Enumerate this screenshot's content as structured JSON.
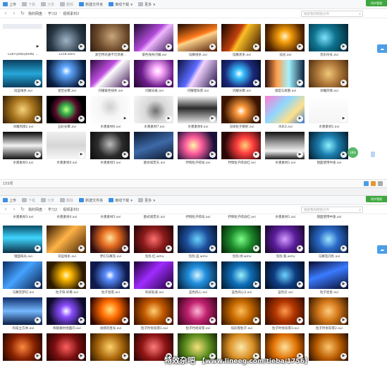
{
  "top": {
    "toolbar": {
      "upload": "上传",
      "download": "下载",
      "share": "分享",
      "delete": "删除",
      "new_folder": "新建文件夹",
      "offline": "离线下载",
      "more": "更多",
      "sync": "同步管理"
    },
    "breadcrumb": [
      "我的网盘",
      "学习2",
      "视频素材2"
    ],
    "search_placeholder": "搜索我的网盘文件",
    "status": "155项",
    "floating_badge": "38%",
    "files": [
      "G(8TQ0N(Q6HN]`...",
      "x258.wmv",
      "演艺特司通不可求要...",
      "紫色线条闪耀.avi",
      "炫舞线条.avi",
      "炫舞黑条.avi",
      "炫光.avi",
      "音乐符号.avi",
      "炫蓝线条.avi",
      "星空光晕.avi",
      "闪耀紫色线条.avi",
      "闪耀光斑.avi",
      "闪耀慢背景.avi",
      "闪耀光晕.avi",
      "渡度与发散.avi",
      "冰雕风情.avi",
      "冰雕风情2.avi",
      "五彩光晕.avi",
      "水墨素材6.avi",
      "水墨素材7.avi",
      "水墨素材8.avi",
      "渲染粒子散射.avi",
      "水彩2.avi",
      "水墨素材2.avi",
      "水墨素材3.avi",
      "水墨素材4.avi",
      "水墨素材5.avi",
      "欧式城堡天.avi",
      "抒情粒子碎动.avi",
      "抒情粒子碎动红.avi",
      "水墨素材1.avi",
      "镜面使用中速.avi"
    ]
  },
  "bottom": {
    "toolbar": {
      "upload": "上传",
      "download": "下载",
      "share": "分享",
      "delete": "删除",
      "new_folder": "新建文件夹",
      "offline": "离线下载",
      "more": "更多",
      "sync": "同步管理"
    },
    "breadcrumb": [
      "我的网盘",
      "学习2",
      "视频素材2"
    ],
    "search_placeholder": "搜索我的网盘文件",
    "partial_row": [
      "水墨素材3.avi",
      "水墨素材4.avi",
      "水墨素材5.avi",
      "欧式城堡天.avi",
      "抒情粒子碎动.avi",
      "抒情粒子碎动红.avi",
      "水墨素材1.avi",
      "镜面使用中速.avi"
    ],
    "files": [
      "镜面阳光.avi",
      "深蓝线条.avi",
      "梦幻马赛克.avi",
      "泡泡-红.wmv",
      "泡泡-蓝.wmv",
      "泡泡-绿.wmv",
      "泡泡-紫.wmv",
      "马赛克闪烁.avi",
      "马赛克梦幻.avi",
      "粒子快 好看.avi",
      "粒子星座.avi",
      "科技轨道.avi",
      "蓝色的心.avi",
      "蓝色的心2.avi",
      "蓝色云.avi",
      "粒子星星.avi",
      "科技立方体.avi",
      "绚丽素材地面闪.avi",
      "动感的星光.avi",
      "粒子时尚背景1.avi",
      "粒子时尚背景.avi",
      "炫彩橙粒子.avi",
      "粒子时尚背景3.avi",
      "粒子时尚背景2.avi",
      "",
      "",
      "",
      "",
      "",
      "",
      "",
      ""
    ]
  },
  "watermark": {
    "main": "特效杂吧",
    "url": "【www.lineeg.com/tieba/1756】"
  }
}
